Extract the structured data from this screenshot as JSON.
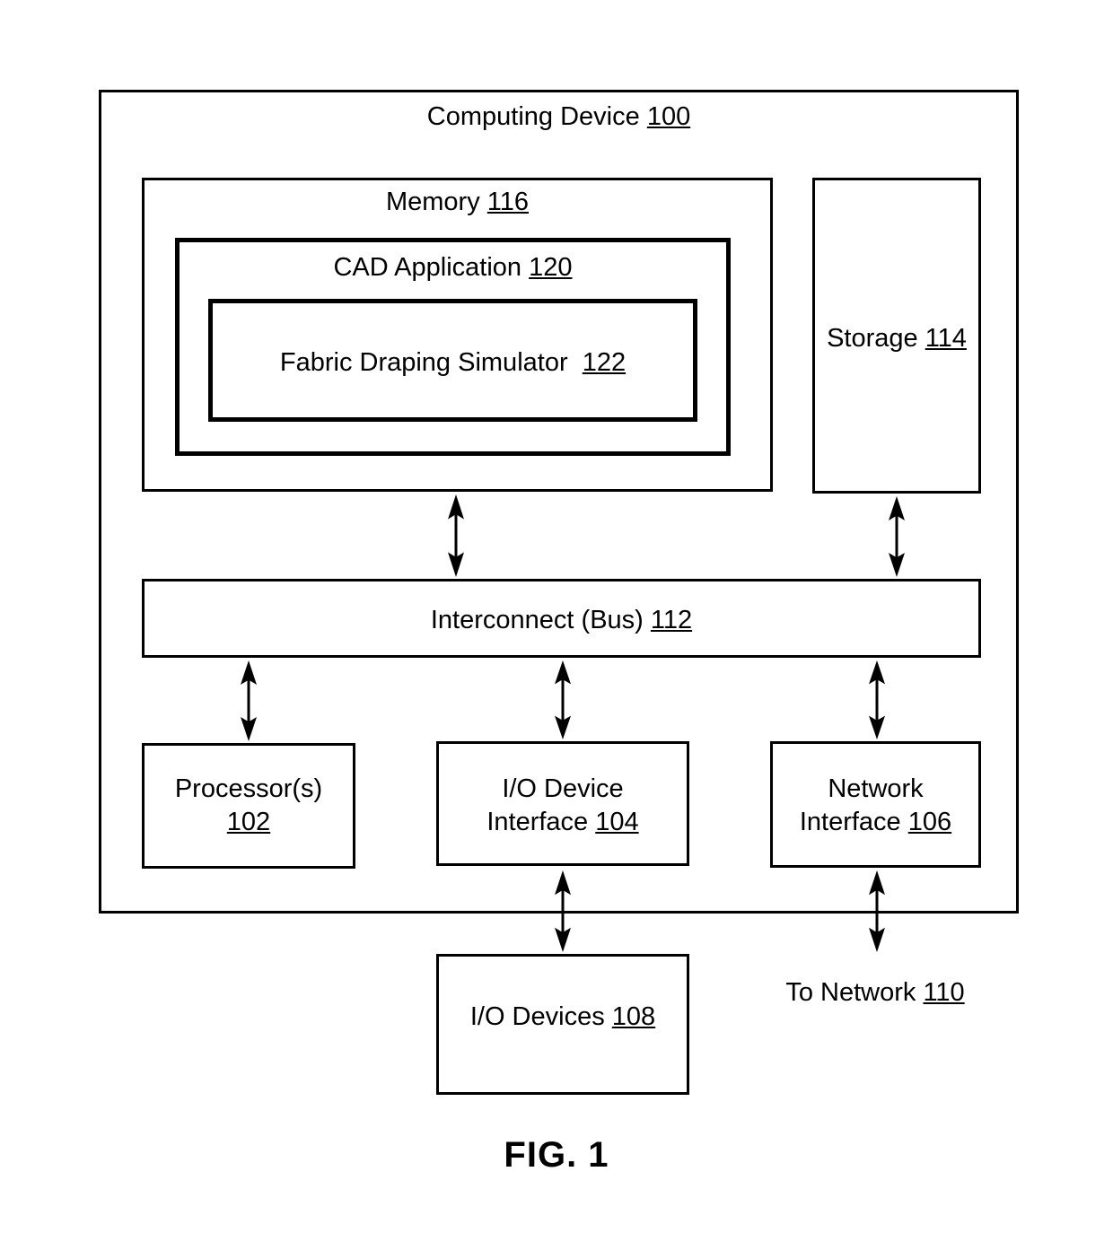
{
  "figure": {
    "caption": "FIG. 1",
    "type": "block-diagram"
  },
  "diagram": {
    "outer": {
      "title_text": "Computing Device",
      "ref": "100"
    },
    "memory": {
      "title_text": "Memory",
      "ref": "116"
    },
    "cad_application": {
      "title_text": "CAD Application",
      "ref": "120"
    },
    "fabric_draping_simulator": {
      "title_text": "Fabric Draping Simulator ",
      "ref": "122"
    },
    "storage": {
      "title_text": "Storage",
      "ref": "114"
    },
    "interconnect": {
      "title_text": "Interconnect (Bus)",
      "ref": "112"
    },
    "processor": {
      "title_text": "Processor(s)",
      "ref": "102"
    },
    "io_device_interface": {
      "title_line1": "I/O Device",
      "title_line2": "Interface",
      "ref": "104"
    },
    "network_interface": {
      "title_line1": "Network",
      "title_line2": "Interface",
      "ref": "106"
    },
    "io_devices": {
      "title_text": "I/O Devices",
      "ref": "108"
    },
    "to_network": {
      "title_text": "To Network",
      "ref": "110"
    },
    "connections": [
      {
        "name": "memory-to-bus",
        "from": "Memory 116",
        "to": "Interconnect (Bus) 112",
        "style": "double-arrow"
      },
      {
        "name": "storage-to-bus",
        "from": "Storage 114",
        "to": "Interconnect (Bus) 112",
        "style": "double-arrow"
      },
      {
        "name": "bus-to-processor",
        "from": "Interconnect (Bus) 112",
        "to": "Processor(s) 102",
        "style": "double-arrow"
      },
      {
        "name": "bus-to-io-device-interface",
        "from": "Interconnect (Bus) 112",
        "to": "I/O Device Interface 104",
        "style": "double-arrow"
      },
      {
        "name": "bus-to-network-interface",
        "from": "Interconnect (Bus) 112",
        "to": "Network Interface 106",
        "style": "double-arrow"
      },
      {
        "name": "io-device-interface-to-io-devices",
        "from": "I/O Device Interface 104",
        "to": "I/O Devices 108",
        "style": "double-arrow"
      },
      {
        "name": "network-interface-to-network",
        "from": "Network Interface 106",
        "to": "To Network 110",
        "style": "double-arrow"
      }
    ]
  },
  "colors": {
    "stroke": "#000000",
    "background": "#ffffff"
  }
}
